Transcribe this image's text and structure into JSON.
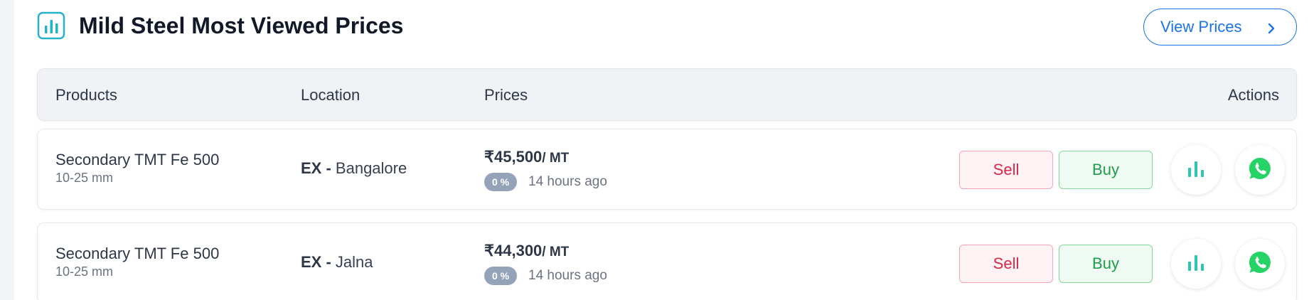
{
  "section": {
    "title": "Mild Steel Most Viewed Prices",
    "view_prices_label": "View Prices"
  },
  "table": {
    "headers": {
      "products": "Products",
      "location": "Location",
      "prices": "Prices",
      "actions": "Actions"
    },
    "rows": [
      {
        "product": "Secondary TMT Fe 500",
        "size": "10-25 mm",
        "location_prefix": "EX -",
        "location": "Bangalore",
        "price": "₹45,500",
        "unit": "/ MT",
        "change": "0 %",
        "time_ago": "14 hours ago",
        "sell_label": "Sell",
        "buy_label": "Buy"
      },
      {
        "product": "Secondary TMT Fe 500",
        "size": "10-25 mm",
        "location_prefix": "EX -",
        "location": "Jalna",
        "price": "₹44,300",
        "unit": "/ MT",
        "change": "0 %",
        "time_ago": "14 hours ago",
        "sell_label": "Sell",
        "buy_label": "Buy"
      }
    ]
  },
  "colors": {
    "accent_blue": "#1a73e8",
    "sell_red": "#d6294a",
    "buy_green": "#1d9c4a",
    "chart_teal": "#2bc7b0",
    "whatsapp_green": "#25d366",
    "title_icon_teal": "#22b3c8"
  },
  "icons": {
    "title": "bar-chart-icon",
    "view_prices": "chevron-right-icon",
    "row_chart": "bar-chart-icon",
    "row_share": "whatsapp-icon"
  }
}
